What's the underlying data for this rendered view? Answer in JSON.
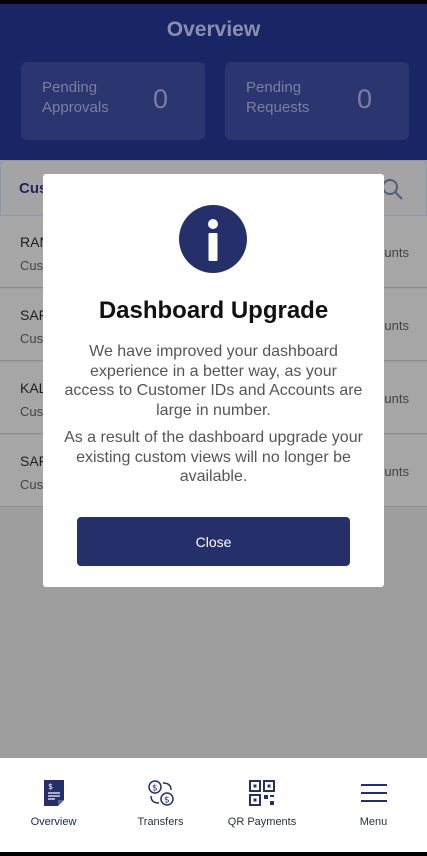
{
  "header": {
    "title": "Overview",
    "cards": [
      {
        "label": "Pending Approvals",
        "value": "0"
      },
      {
        "label": "Pending Requests",
        "value": "0"
      }
    ]
  },
  "search": {
    "text": "Cus"
  },
  "rows": [
    {
      "name": "RAN",
      "sub": "Cus",
      "right": "unts"
    },
    {
      "name": "SAF",
      "sub": "Cus",
      "right": "unts"
    },
    {
      "name": "KAL",
      "sub": "Cus",
      "right": "unts"
    },
    {
      "name": "SAF",
      "sub": "Cus",
      "right": "unts"
    }
  ],
  "modal": {
    "title": "Dashboard Upgrade",
    "paragraph1": "We have improved your dashboard experience in a better way, as your access to Customer IDs and Accounts are large in number.",
    "paragraph2": "As a result of the dashboard upgrade your existing custom views will no longer be available.",
    "close_label": "Close"
  },
  "nav": {
    "items": [
      {
        "label": "Overview",
        "icon": "document-dollar-icon"
      },
      {
        "label": "Transfers",
        "icon": "transfer-icon"
      },
      {
        "label": "QR Payments",
        "icon": "qr-code-icon"
      },
      {
        "label": "Menu",
        "icon": "hamburger-icon"
      }
    ]
  },
  "colors": {
    "primary": "#1a2566",
    "button": "#25306b"
  }
}
